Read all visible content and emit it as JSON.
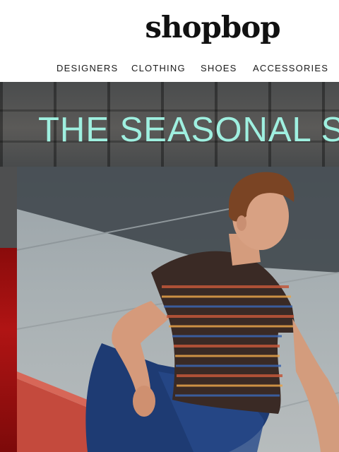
{
  "brand": {
    "logo_text": "shopbop"
  },
  "nav": {
    "items": [
      {
        "label": "DESIGNERS"
      },
      {
        "label": "CLOTHING"
      },
      {
        "label": "SHOES"
      },
      {
        "label": "ACCESSORIES"
      }
    ]
  },
  "hero": {
    "title": "THE SEASONAL SH",
    "image": "man-in-striped-tshirt-sitting-on-curb",
    "accent_color": "#9ff0e0"
  }
}
